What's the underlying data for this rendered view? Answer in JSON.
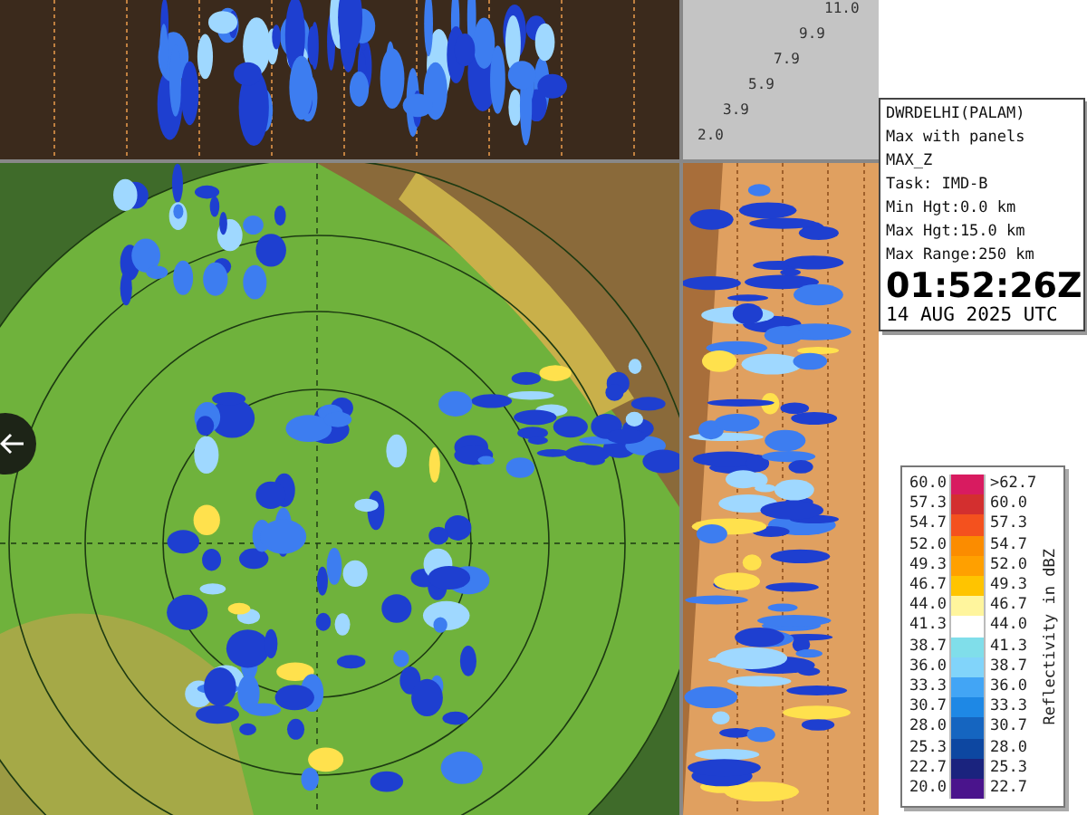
{
  "height_scale": [
    "11.0",
    "9.9",
    "7.9",
    "5.9",
    "3.9",
    "2.0"
  ],
  "info": {
    "lines": [
      "DWRDELHI(PALAM)",
      "Max with panels",
      "MAX_Z",
      "Task: IMD-B",
      "Min Hgt:0.0 km",
      "Max Hgt:15.0 km",
      "Max Range:250 km"
    ],
    "time": "01:52:26Z",
    "date": "14 AUG 2025 UTC"
  },
  "legend": {
    "title": "Reflectivity in dBZ",
    "rows": [
      {
        "low": "60.0",
        "high": ">62.7",
        "color": "#d81b60"
      },
      {
        "low": "57.3",
        "high": "60.0",
        "color": "#d32f2f"
      },
      {
        "low": "54.7",
        "high": "57.3",
        "color": "#f4511e"
      },
      {
        "low": "52.0",
        "high": "54.7",
        "color": "#fb8c00"
      },
      {
        "low": "49.3",
        "high": "52.0",
        "color": "#ffa000"
      },
      {
        "low": "46.7",
        "high": "49.3",
        "color": "#ffc400"
      },
      {
        "low": "44.0",
        "high": "46.7",
        "color": "#fff59d"
      },
      {
        "low": "41.3",
        "high": "44.0",
        "color": "#ffffff"
      },
      {
        "low": "38.7",
        "high": "41.3",
        "color": "#80deea"
      },
      {
        "low": "36.0",
        "high": "38.7",
        "color": "#81d4fa"
      },
      {
        "low": "33.3",
        "high": "36.0",
        "color": "#42a5f5"
      },
      {
        "low": "30.7",
        "high": "33.3",
        "color": "#1e88e5"
      },
      {
        "low": "28.0",
        "high": "30.7",
        "color": "#1565c0"
      },
      {
        "low": "25.3",
        "high": "28.0",
        "color": "#0d47a1"
      },
      {
        "low": "22.7",
        "high": "25.3",
        "color": "#1a237e"
      },
      {
        "low": "20.0",
        "high": "22.7",
        "color": "#4a148c"
      }
    ]
  }
}
